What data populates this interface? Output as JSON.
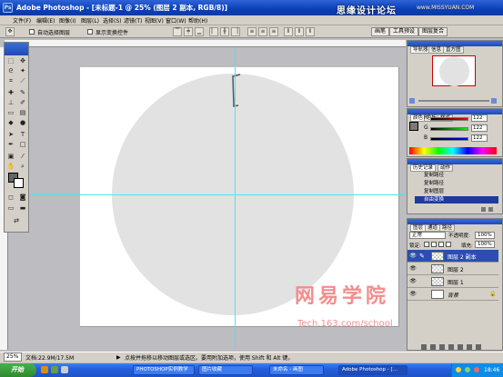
{
  "window": {
    "icon": "Ps",
    "title": "Adobe Photoshop - [未标题-1 @ 25% (图层 2 副本, RGB/8)]",
    "overlay_text": "思缘设计论坛",
    "overlay_url": "www.MISSYUAN.COM"
  },
  "menu": [
    "文件(F)",
    "编辑(E)",
    "图像(I)",
    "图层(L)",
    "选择(S)",
    "滤镜(T)",
    "视图(V)",
    "窗口(W)",
    "帮助(H)"
  ],
  "options": {
    "tool_icon": "move-tool-icon",
    "auto_select": "自动选择图层",
    "show_bounds": "显示变换控件",
    "well_tabs": [
      "画笔",
      "工具预设",
      "图层复合"
    ]
  },
  "document": {
    "zoom": "25%",
    "doc_size": "文档:22.9M/17.5M",
    "status_hint": "点按并拖移以移动图层或选区。要用附加选项，使用 Shift 和 Alt 键。",
    "canvas_color": "#ffffff",
    "circle_color": "#e2e2e2",
    "guide_color": "#4fe3ef"
  },
  "watermark": {
    "logo": "网易学院",
    "site": "Tech.163.com/school"
  },
  "navigator": {
    "tabs": [
      "导航器",
      "信息",
      "直方图"
    ]
  },
  "color_panel": {
    "tabs": [
      "颜色",
      "色板",
      "样式"
    ],
    "channels": [
      {
        "label": "R",
        "value": "122"
      },
      {
        "label": "G",
        "value": "122"
      },
      {
        "label": "B",
        "value": "122"
      }
    ]
  },
  "history": {
    "tabs": [
      "历史记录",
      "动作"
    ],
    "items": [
      "复制路径",
      "复制路径",
      "复制图层",
      "自由变换"
    ]
  },
  "layers": {
    "tabs": [
      "图层",
      "通道",
      "路径"
    ],
    "blend_mode": "正常",
    "opacity_label": "不透明度:",
    "opacity": "100%",
    "lock_label": "锁定:",
    "fill_label": "填充:",
    "fill": "100%",
    "items": [
      {
        "name": "图层 2 副本",
        "selected": true
      },
      {
        "name": "图层 2",
        "selected": false
      },
      {
        "name": "图层 1",
        "selected": false
      },
      {
        "name": "背景",
        "selected": false
      }
    ]
  },
  "taskbar": {
    "start": "开始",
    "buttons": [
      "PHOTOSHOP实例教学",
      "图片收藏",
      "未命名 - 画图",
      "Adobe Photoshop - [..."
    ],
    "clock": "18:46"
  }
}
